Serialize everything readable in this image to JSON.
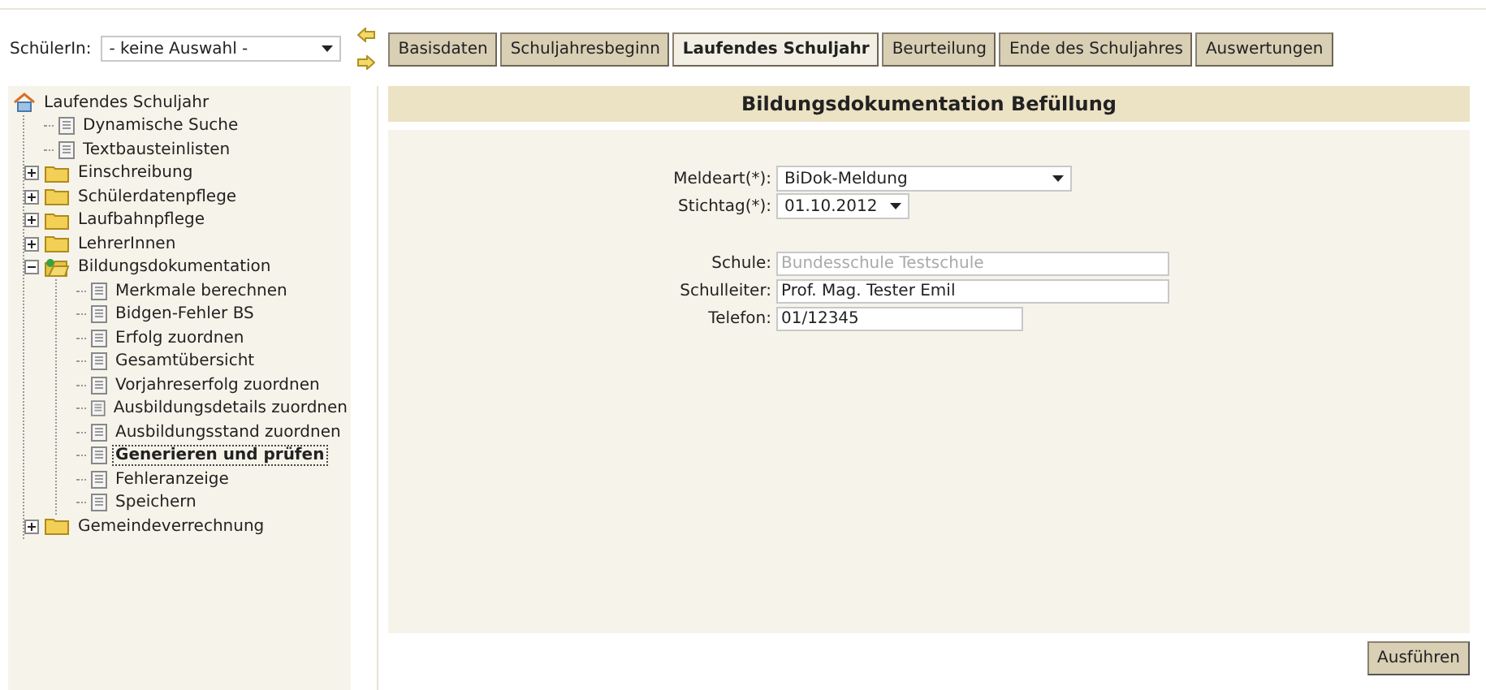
{
  "student_select": {
    "label": "SchülerIn:",
    "value": "- keine Auswahl -"
  },
  "tabs": [
    {
      "label": "Basisdaten",
      "selected": false
    },
    {
      "label": "Schuljahresbeginn",
      "selected": false
    },
    {
      "label": "Laufendes Schuljahr",
      "selected": true
    },
    {
      "label": "Beurteilung",
      "selected": false
    },
    {
      "label": "Ende des Schuljahres",
      "selected": false
    },
    {
      "label": "Auswertungen",
      "selected": false
    }
  ],
  "tree": {
    "root": "Laufendes Schuljahr",
    "items": [
      {
        "kind": "doc",
        "label": "Dynamische Suche",
        "selected": false
      },
      {
        "kind": "doc",
        "label": "Textbausteinlisten",
        "selected": false
      },
      {
        "kind": "folder",
        "label": "Einschreibung",
        "expanded": false,
        "selected": false
      },
      {
        "kind": "folder",
        "label": "Schülerdatenpflege",
        "expanded": false,
        "selected": false
      },
      {
        "kind": "folder",
        "label": "Laufbahnpflege",
        "expanded": false,
        "selected": false
      },
      {
        "kind": "folder",
        "label": "LehrerInnen",
        "expanded": false,
        "selected": false
      },
      {
        "kind": "folder",
        "label": "Bildungsdokumentation",
        "expanded": true,
        "selected": false,
        "children": [
          {
            "kind": "doc",
            "label": "Merkmale berechnen",
            "selected": false
          },
          {
            "kind": "doc",
            "label": "Bidgen-Fehler BS",
            "selected": false
          },
          {
            "kind": "doc",
            "label": "Erfolg zuordnen",
            "selected": false
          },
          {
            "kind": "doc",
            "label": "Gesamtübersicht",
            "selected": false
          },
          {
            "kind": "doc",
            "label": "Vorjahreserfolg zuordnen",
            "selected": false
          },
          {
            "kind": "doc",
            "label": "Ausbildungsdetails zuordnen",
            "selected": false
          },
          {
            "kind": "doc",
            "label": "Ausbildungsstand zuordnen",
            "selected": false
          },
          {
            "kind": "doc",
            "label": "Generieren und prüfen",
            "selected": true
          },
          {
            "kind": "doc",
            "label": "Fehleranzeige",
            "selected": false
          },
          {
            "kind": "doc",
            "label": "Speichern",
            "selected": false
          }
        ]
      },
      {
        "kind": "folder",
        "label": "Gemeindeverrechnung",
        "expanded": false,
        "selected": false
      }
    ]
  },
  "panel": {
    "title": "Bildungsdokumentation Befüllung",
    "fields": [
      {
        "kind": "select",
        "label": "Meldeart(*):",
        "value": "BiDok-Meldung"
      },
      {
        "kind": "select",
        "label": "Stichtag(*):",
        "value": "01.10.2012"
      },
      {
        "kind": "spacer"
      },
      {
        "kind": "input",
        "label": "Schule:",
        "value": "Bundesschule Testschule",
        "disabled": true
      },
      {
        "kind": "input",
        "label": "Schulleiter:",
        "value": "Prof. Mag. Tester Emil",
        "disabled": false
      },
      {
        "kind": "input",
        "label": "Telefon:",
        "value": "01/12345",
        "disabled": false
      }
    ],
    "button": "Ausführen"
  }
}
